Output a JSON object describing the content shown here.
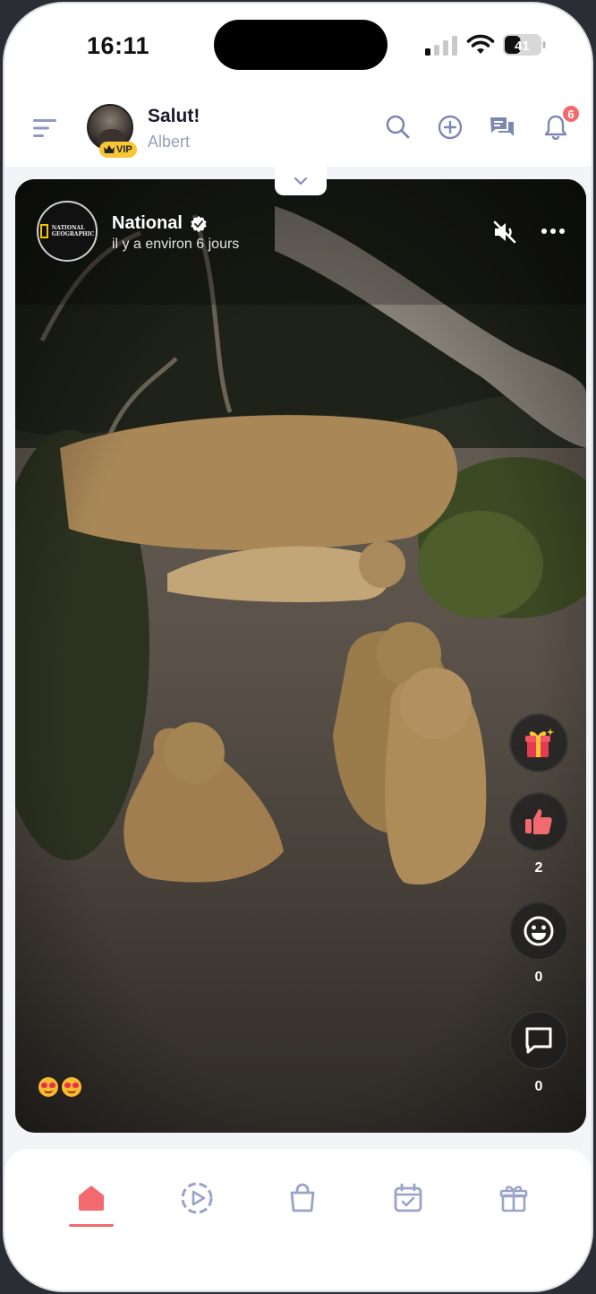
{
  "status_bar": {
    "time": "16:11",
    "battery_level": "41"
  },
  "header": {
    "greeting": "Salut!",
    "username": "Albert",
    "vip_label": "VIP",
    "notification_count": "6"
  },
  "post": {
    "author": "National",
    "verified": true,
    "posted_time": "il y a environ 6 jours",
    "likes_count": "2",
    "reactions_count": "0",
    "comments_count": "0"
  },
  "colors": {
    "accent": "#f06a6f",
    "icon": "#8f99c0",
    "header_icon": "#7d87b3",
    "vip": "#f7c634"
  },
  "icons": {
    "header": [
      "menu-icon",
      "search-icon",
      "add-circle-icon",
      "chat-icon",
      "bell-icon"
    ],
    "post": [
      "verified-icon",
      "mute-icon",
      "more-icon",
      "gift-icon",
      "thumbs-up-icon",
      "smiley-icon",
      "comment-icon"
    ],
    "nav": [
      "home-icon",
      "play-icon",
      "bag-icon",
      "calendar-icon",
      "gift-icon"
    ]
  }
}
